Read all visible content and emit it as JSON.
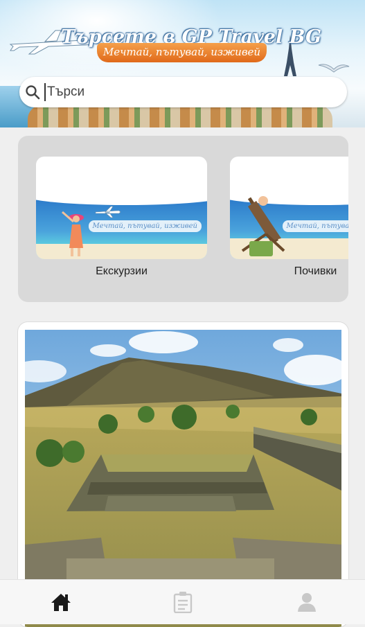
{
  "header": {
    "title": "Търсете в GP Travel BG",
    "slogan": "Мечтай, пътувай, изживей"
  },
  "search": {
    "placeholder": "Търси",
    "value": ""
  },
  "categories": [
    {
      "label": "Екскурзии",
      "thumb_slogan": "Мечтай, пътувай, изживей"
    },
    {
      "label": "Почивки",
      "thumb_slogan": "Мечтай, пътувай, изживей"
    }
  ],
  "featured": {
    "image_icon": "pyramid-landscape-image"
  },
  "nav": {
    "items": [
      {
        "icon": "home-icon",
        "active": true
      },
      {
        "icon": "clipboard-icon",
        "active": false
      },
      {
        "icon": "user-icon",
        "active": false
      }
    ]
  },
  "colors": {
    "accent_orange": "#e0691a",
    "title_blue": "#2b5d8c",
    "nav_active": "#1a1a1a",
    "nav_inactive": "#c8c8c8"
  }
}
